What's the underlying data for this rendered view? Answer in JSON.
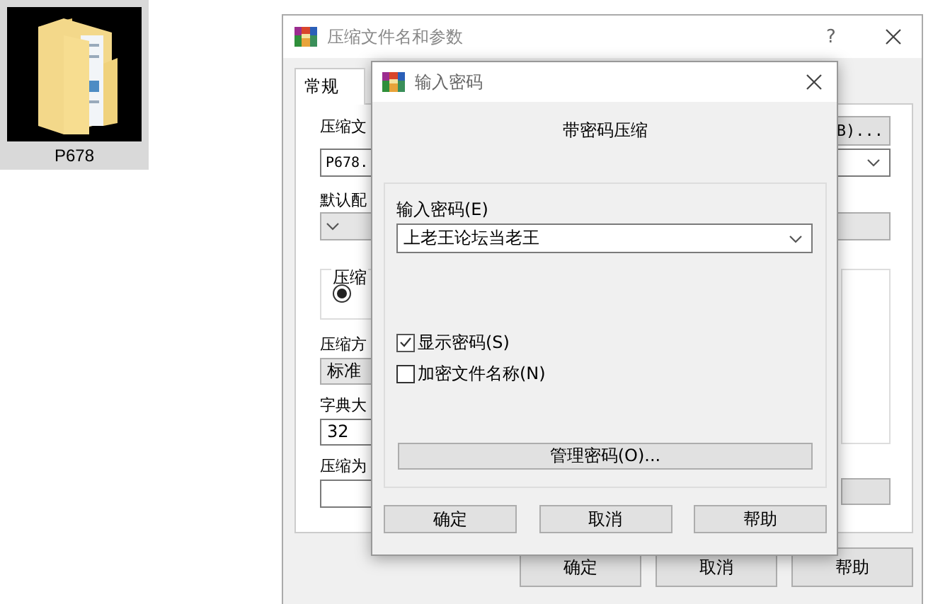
{
  "desktop_icon": {
    "label": "P678",
    "selected": true
  },
  "archive_dialog": {
    "title": "压缩文件名和参数",
    "help_glyph": "?",
    "tabs": [
      {
        "label": "常规",
        "selected": true
      }
    ],
    "archive_name_label": "压缩文",
    "browse_button": "B)...",
    "archive_name_value": "P678.",
    "profile_label": "默认配",
    "format_group_label": "压缩",
    "format_radio": {
      "selected": true
    },
    "method_label": "压缩方",
    "method_value": "标准",
    "dictionary_label": "字典大",
    "dictionary_value": "32",
    "split_label": "压缩为",
    "buttons": [
      "确定",
      "取消",
      "帮助"
    ]
  },
  "password_dialog": {
    "title": "输入密码",
    "heading": "带密码压缩",
    "password_label": "输入密码(E)",
    "password_value": "上老王论坛当老王",
    "options": [
      {
        "label": "显示密码(S)",
        "checked": true
      },
      {
        "label": "加密文件名称(N)",
        "checked": false
      }
    ],
    "manage_button": "管理密码(O)...",
    "buttons": [
      "确定",
      "取消",
      "帮助"
    ]
  }
}
